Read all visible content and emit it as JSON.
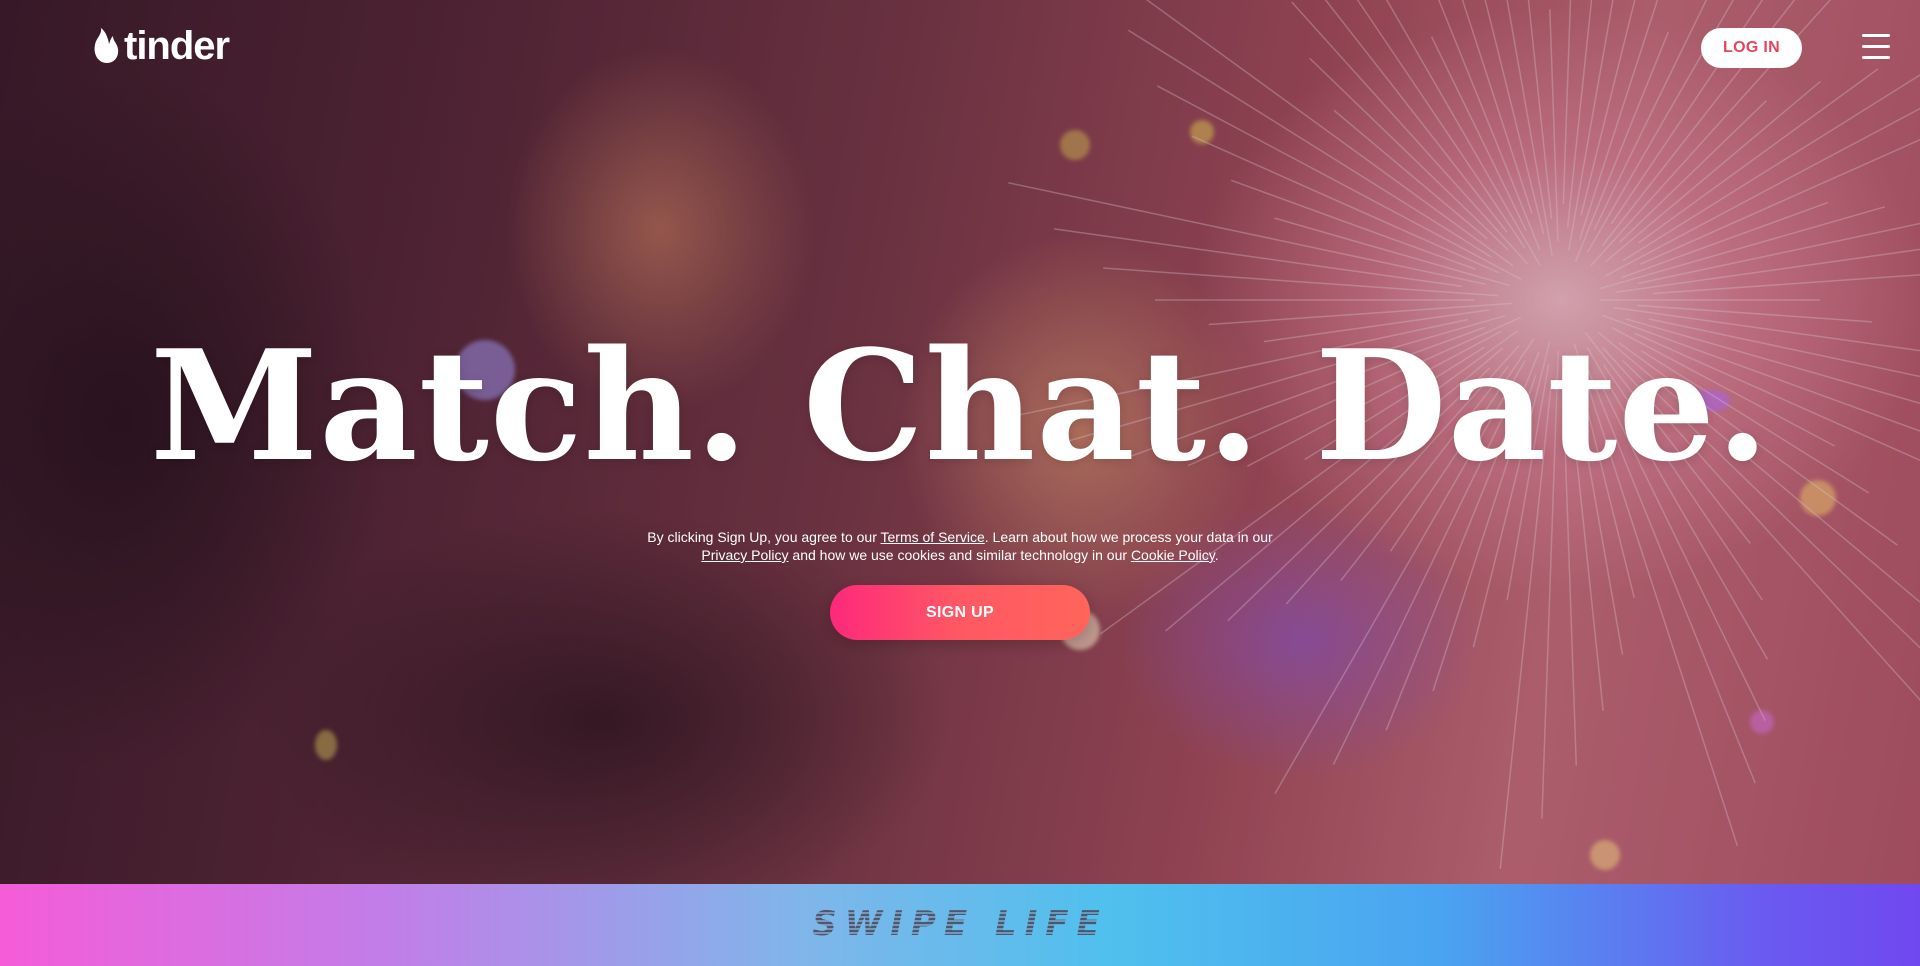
{
  "header": {
    "logo_text": "tinder",
    "login_label": "LOG IN",
    "menu_icon": "hamburger-menu-icon"
  },
  "hero": {
    "headline": "Match. Chat. Date.",
    "legal": {
      "part1": "By clicking Sign Up, you agree to our ",
      "terms_link": "Terms of Service",
      "part2": ". Learn about how we process your data in our ",
      "privacy_link": "Privacy Policy",
      "part3": " and how we use cookies and similar technology in our ",
      "cookie_link": "Cookie Policy",
      "part4": "."
    },
    "signup_label": "SIGN UP"
  },
  "banner": {
    "title": "SWIPE LIFE"
  },
  "colors": {
    "brand_pink": "#fd297b",
    "brand_coral": "#ff655b",
    "login_text": "#e8445e"
  }
}
